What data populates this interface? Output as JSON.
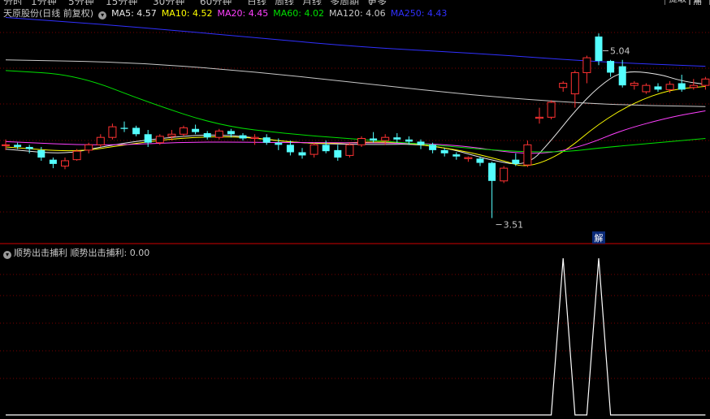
{
  "toolbar": {
    "tabs": [
      "分时",
      "1分钟",
      "5分钟",
      "15分钟",
      "30分钟",
      "60分钟",
      "日线",
      "周线",
      "月线",
      "多周期",
      "更多"
    ],
    "right_buttons": [
      "提取",
      "叠加"
    ]
  },
  "legend": {
    "title": "天原股份(日线 前复权)",
    "items": [
      {
        "label": "MA5: 4.57",
        "color": "#e8e8e8"
      },
      {
        "label": "MA10: 4.52",
        "color": "#ffff00"
      },
      {
        "label": "MA20: 4.45",
        "color": "#ff40ff"
      },
      {
        "label": "MA60: 4.02",
        "color": "#00e000"
      },
      {
        "label": "MA120: 4.06",
        "color": "#c8c8c8"
      },
      {
        "label": "MA250: 4.43",
        "color": "#3030ff"
      }
    ]
  },
  "indicator": {
    "label": "顺势出击捕利  顺势出击捕利: 0.00"
  },
  "colors": {
    "up": "#ff3232",
    "down": "#54ffff",
    "bg": "#000000",
    "divider": "#8b0000",
    "grid": "#7a0000"
  },
  "chart_data": [
    {
      "type": "candlestick",
      "ylim": [
        3.3,
        5.35
      ],
      "annotations": [
        {
          "text": "5.04",
          "value": 5.04,
          "index": 50
        },
        {
          "text": "3.51",
          "value": 3.51,
          "index": 41
        },
        {
          "text": "解",
          "index": 50
        }
      ],
      "candles": [
        [
          4.2,
          4.25,
          4.15,
          4.2
        ],
        [
          4.2,
          4.22,
          4.16,
          4.18
        ],
        [
          4.18,
          4.2,
          4.12,
          4.16
        ],
        [
          4.15,
          4.18,
          4.05,
          4.08
        ],
        [
          4.06,
          4.08,
          3.98,
          4.02
        ],
        [
          4.0,
          4.08,
          3.97,
          4.05
        ],
        [
          4.06,
          4.16,
          4.05,
          4.14
        ],
        [
          4.15,
          4.22,
          4.12,
          4.2
        ],
        [
          4.2,
          4.3,
          4.18,
          4.27
        ],
        [
          4.27,
          4.4,
          4.25,
          4.37
        ],
        [
          4.36,
          4.42,
          4.32,
          4.35
        ],
        [
          4.36,
          4.38,
          4.28,
          4.3
        ],
        [
          4.3,
          4.34,
          4.18,
          4.22
        ],
        [
          4.22,
          4.3,
          4.2,
          4.28
        ],
        [
          4.28,
          4.34,
          4.24,
          4.3
        ],
        [
          4.3,
          4.38,
          4.28,
          4.36
        ],
        [
          4.35,
          4.39,
          4.3,
          4.32
        ],
        [
          4.31,
          4.33,
          4.25,
          4.27
        ],
        [
          4.27,
          4.35,
          4.25,
          4.33
        ],
        [
          4.33,
          4.35,
          4.27,
          4.3
        ],
        [
          4.29,
          4.31,
          4.24,
          4.26
        ],
        [
          4.26,
          4.3,
          4.2,
          4.27
        ],
        [
          4.27,
          4.3,
          4.2,
          4.22
        ],
        [
          4.22,
          4.26,
          4.15,
          4.2
        ],
        [
          4.2,
          4.24,
          4.1,
          4.13
        ],
        [
          4.13,
          4.17,
          4.07,
          4.1
        ],
        [
          4.11,
          4.22,
          4.08,
          4.2
        ],
        [
          4.2,
          4.24,
          4.12,
          4.14
        ],
        [
          4.15,
          4.2,
          4.05,
          4.08
        ],
        [
          4.1,
          4.22,
          4.08,
          4.2
        ],
        [
          4.2,
          4.28,
          4.18,
          4.26
        ],
        [
          4.26,
          4.32,
          4.22,
          4.24
        ],
        [
          4.24,
          4.3,
          4.2,
          4.27
        ],
        [
          4.27,
          4.31,
          4.22,
          4.25
        ],
        [
          4.25,
          4.28,
          4.2,
          4.23
        ],
        [
          4.23,
          4.25,
          4.16,
          4.2
        ],
        [
          4.2,
          4.22,
          4.12,
          4.15
        ],
        [
          4.15,
          4.17,
          4.09,
          4.12
        ],
        [
          4.11,
          4.13,
          4.06,
          4.09
        ],
        [
          4.07,
          4.09,
          4.04,
          4.08
        ],
        [
          4.07,
          4.09,
          4.0,
          4.03
        ],
        [
          4.03,
          4.04,
          3.51,
          3.86
        ],
        [
          3.86,
          4.0,
          3.84,
          3.98
        ],
        [
          4.06,
          4.12,
          4.0,
          4.02
        ],
        [
          4.01,
          4.24,
          3.99,
          4.2
        ],
        [
          4.45,
          4.55,
          4.4,
          4.46
        ],
        [
          4.46,
          4.62,
          4.44,
          4.6
        ],
        [
          4.74,
          4.8,
          4.7,
          4.78
        ],
        [
          4.68,
          4.9,
          4.55,
          4.88
        ],
        [
          4.88,
          5.04,
          4.78,
          5.02
        ],
        [
          5.22,
          5.25,
          4.95,
          4.99
        ],
        [
          4.99,
          5.0,
          4.84,
          4.88
        ],
        [
          4.94,
          5.0,
          4.74,
          4.76
        ],
        [
          4.76,
          4.8,
          4.72,
          4.78
        ],
        [
          4.7,
          4.78,
          4.68,
          4.76
        ],
        [
          4.75,
          4.78,
          4.7,
          4.72
        ],
        [
          4.72,
          4.8,
          4.69,
          4.77
        ],
        [
          4.78,
          4.86,
          4.7,
          4.72
        ],
        [
          4.74,
          4.82,
          4.72,
          4.76
        ],
        [
          4.76,
          4.84,
          4.72,
          4.82
        ]
      ],
      "ma": [
        {
          "name": "MA5",
          "color": "#e8e8e8",
          "points": [
            [
              0,
              4.16
            ],
            [
              5,
              4.11
            ],
            [
              8,
              4.18
            ],
            [
              12,
              4.25
            ],
            [
              18,
              4.31
            ],
            [
              24,
              4.22
            ],
            [
              30,
              4.2
            ],
            [
              36,
              4.21
            ],
            [
              41,
              4.05
            ],
            [
              44,
              4.0
            ],
            [
              46,
              4.24
            ],
            [
              48,
              4.52
            ],
            [
              50,
              4.75
            ],
            [
              52,
              4.9
            ],
            [
              55,
              4.87
            ],
            [
              57,
              4.8
            ],
            [
              59,
              4.77
            ]
          ]
        },
        {
          "name": "MA10",
          "color": "#ffff00",
          "points": [
            [
              0,
              4.18
            ],
            [
              6,
              4.13
            ],
            [
              10,
              4.2
            ],
            [
              15,
              4.27
            ],
            [
              20,
              4.28
            ],
            [
              26,
              4.2
            ],
            [
              32,
              4.24
            ],
            [
              38,
              4.16
            ],
            [
              42,
              4.05
            ],
            [
              44,
              3.98
            ],
            [
              47,
              4.12
            ],
            [
              50,
              4.4
            ],
            [
              53,
              4.6
            ],
            [
              56,
              4.72
            ],
            [
              59,
              4.75
            ]
          ]
        },
        {
          "name": "MA20",
          "color": "#ff40ff",
          "points": [
            [
              0,
              4.23
            ],
            [
              8,
              4.19
            ],
            [
              16,
              4.23
            ],
            [
              24,
              4.22
            ],
            [
              32,
              4.22
            ],
            [
              38,
              4.2
            ],
            [
              43,
              4.12
            ],
            [
              46,
              4.12
            ],
            [
              49,
              4.2
            ],
            [
              52,
              4.34
            ],
            [
              56,
              4.46
            ],
            [
              59,
              4.52
            ]
          ]
        },
        {
          "name": "MA60",
          "color": "#00e000",
          "points": [
            [
              0,
              4.9
            ],
            [
              6,
              4.86
            ],
            [
              12,
              4.6
            ],
            [
              18,
              4.38
            ],
            [
              24,
              4.3
            ],
            [
              30,
              4.25
            ],
            [
              36,
              4.2
            ],
            [
              42,
              4.14
            ],
            [
              47,
              4.13
            ],
            [
              50,
              4.17
            ],
            [
              54,
              4.21
            ],
            [
              59,
              4.26
            ]
          ]
        },
        {
          "name": "MA120",
          "color": "#c8c8c8",
          "points": [
            [
              0,
              5.0
            ],
            [
              10,
              4.98
            ],
            [
              20,
              4.9
            ],
            [
              30,
              4.78
            ],
            [
              40,
              4.66
            ],
            [
              50,
              4.58
            ],
            [
              59,
              4.56
            ]
          ]
        },
        {
          "name": "MA250",
          "color": "#3030ff",
          "points": [
            [
              0,
              5.4
            ],
            [
              10,
              5.32
            ],
            [
              20,
              5.22
            ],
            [
              30,
              5.12
            ],
            [
              40,
              5.06
            ],
            [
              50,
              4.98
            ],
            [
              59,
              4.94
            ]
          ]
        }
      ]
    },
    {
      "type": "line",
      "name": "顺势出击捕利",
      "ylim": [
        0,
        1
      ],
      "points": [
        [
          0,
          0
        ],
        [
          46,
          0
        ],
        [
          47,
          1
        ],
        [
          48,
          0
        ],
        [
          49,
          0
        ],
        [
          50,
          1
        ],
        [
          51,
          0
        ],
        [
          59,
          0
        ]
      ]
    }
  ]
}
